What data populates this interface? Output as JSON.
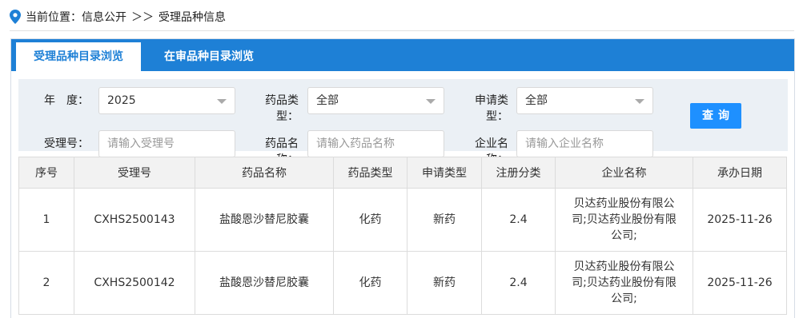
{
  "breadcrumb": {
    "prefix": "当前位置：",
    "section": "信息公开",
    "separator": "＞＞",
    "page": "受理品种信息"
  },
  "tabs": [
    {
      "label": "受理品种目录浏览",
      "active": true
    },
    {
      "label": "在审品种目录浏览",
      "active": false
    }
  ],
  "filters": {
    "year": {
      "label": "年　度：",
      "value": "2025"
    },
    "drug_type": {
      "label_line1": "药品类",
      "label_line2": "型：",
      "value": "全部"
    },
    "apply_type": {
      "label_line1": "申请类",
      "label_line2": "型：",
      "value": "全部"
    },
    "accept_no": {
      "label": "受理号：",
      "placeholder": "请输入受理号"
    },
    "drug_name": {
      "label_line1": "药品名",
      "label_line2": "称：",
      "placeholder": "请输入药品名称"
    },
    "company": {
      "label_line1": "企业名",
      "label_line2": "称：",
      "placeholder": "请输入企业名称"
    },
    "query_button": "查询"
  },
  "table": {
    "columns": [
      "序号",
      "受理号",
      "药品名称",
      "药品类型",
      "申请类型",
      "注册分类",
      "企业名称",
      "承办日期"
    ],
    "rows": [
      {
        "no": "1",
        "accept_no": "CXHS2500143",
        "drug_name": "盐酸恩沙替尼胶囊",
        "drug_type": "化药",
        "apply_type": "新药",
        "reg_class": "2.4",
        "company": "贝达药业股份有限公司;贝达药业股份有限公司;",
        "date": "2025-11-26"
      },
      {
        "no": "2",
        "accept_no": "CXHS2500142",
        "drug_name": "盐酸恩沙替尼胶囊",
        "drug_type": "化药",
        "apply_type": "新药",
        "reg_class": "2.4",
        "company": "贝达药业股份有限公司;贝达药业股份有限公司;",
        "date": "2025-11-26"
      }
    ]
  },
  "colors": {
    "accent": "#1e80d6",
    "button": "#1e90ff",
    "filter_bg": "#ebf0f5"
  }
}
